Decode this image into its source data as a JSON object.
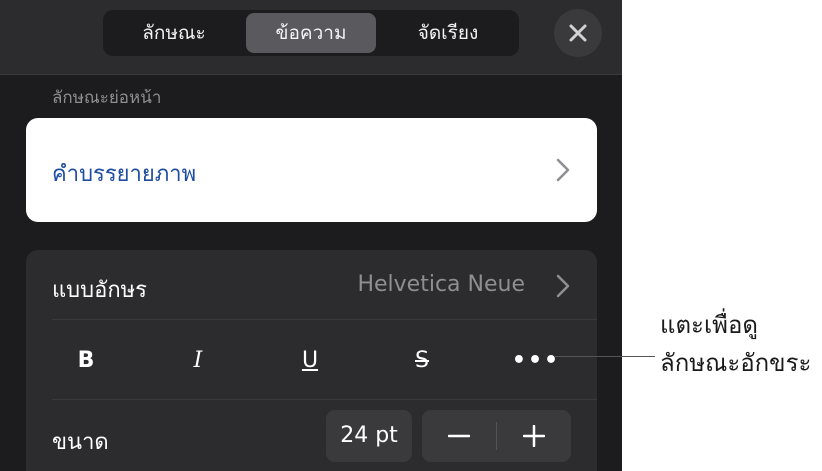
{
  "tabs": [
    {
      "label": "ลักษณะ",
      "selected": false
    },
    {
      "label": "ข้อความ",
      "selected": true
    },
    {
      "label": "จัดเรียง",
      "selected": false
    }
  ],
  "close_icon": "close-icon",
  "paragraph_style": {
    "section_label": "ลักษณะย่อหน้า",
    "value": "คำบรรยายภาพ"
  },
  "font": {
    "label": "แบบอักษร",
    "value": "Helvetica Neue"
  },
  "text_styles": {
    "bold": "B",
    "italic": "I",
    "underline": "U",
    "strikethrough": "S",
    "more": "•••"
  },
  "size": {
    "label": "ขนาด",
    "value": "24 pt"
  },
  "callout": {
    "line1": "แตะเพื่อดู",
    "line2": "ลักษณะอักขระ"
  },
  "colors": {
    "panel_bg": "#1c1c1e",
    "group_bg": "#2c2c2e",
    "accent_blue": "#1f4da1",
    "selected_tab": "#5a5a5e"
  }
}
